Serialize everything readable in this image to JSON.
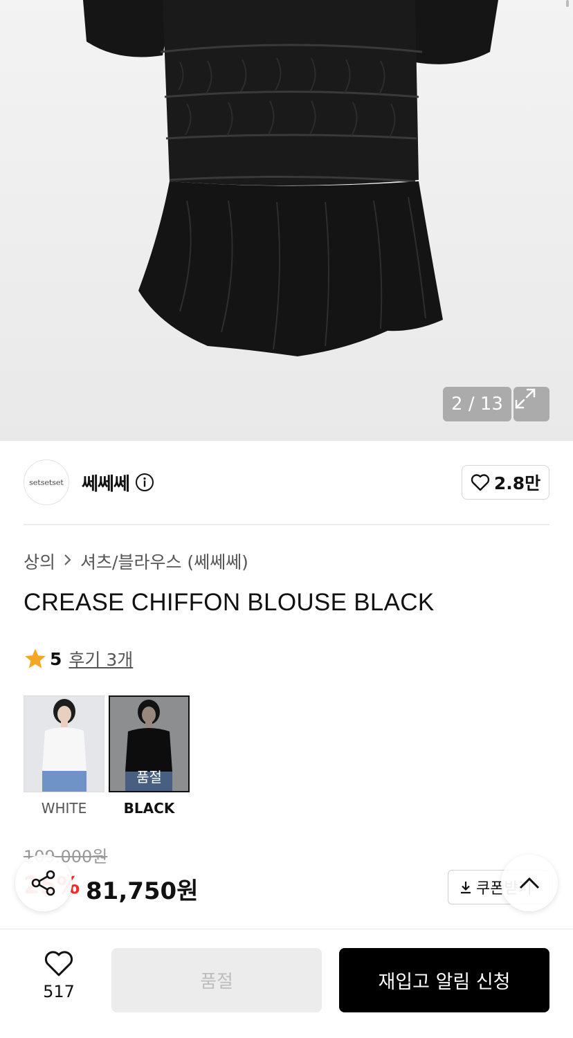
{
  "gallery": {
    "counter": "2 / 13",
    "expand_icon": "expand-icon"
  },
  "brand": {
    "logo_text": "setsetset",
    "name": "쎄쎄쎄",
    "likes": "2.8만"
  },
  "breadcrumb": {
    "category": "상의",
    "subcategory": "셔츠/블라우스 (쎄쎄쎄)"
  },
  "product": {
    "title": "CREASE CHIFFON BLOUSE BLACK",
    "rating": "5",
    "reviews": "후기 3개"
  },
  "colors": [
    {
      "label": "WHITE",
      "selected": false
    },
    {
      "label": "BLACK",
      "selected": true,
      "badge": "품절"
    }
  ],
  "price": {
    "original": "109,000원",
    "discount": "25%",
    "sale": "81,750원",
    "coupon": "쿠폰받기"
  },
  "bottom_bar": {
    "wish_count": "517",
    "soldout_label": "품절",
    "restock_label": "재입고 알림 신청"
  },
  "colors_theme": {
    "accent": "#f32c2c",
    "star": "#f5a623",
    "primary": "#000000"
  }
}
